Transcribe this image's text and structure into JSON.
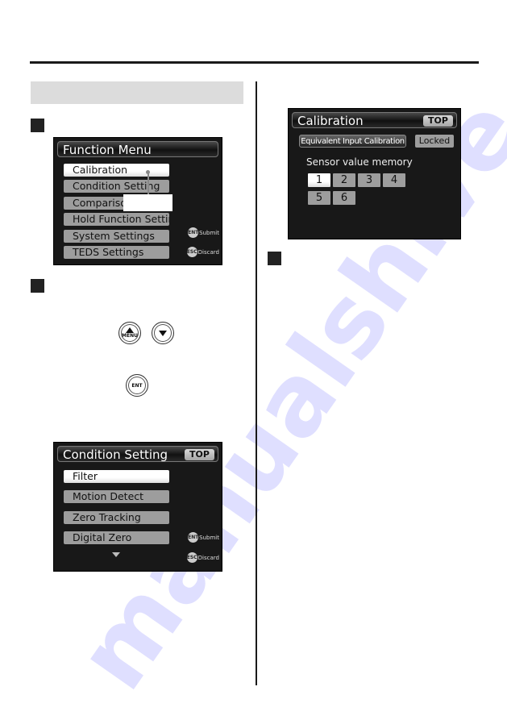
{
  "watermark": "manualshive.com",
  "function_menu_screen": {
    "title": "Function Menu",
    "items": [
      "Calibration",
      "Condition Setting",
      "Comparison",
      "Hold Function Setting",
      "System Settings",
      "TEDS Settings"
    ],
    "selected_index": 0,
    "hints": [
      {
        "key": "ENT",
        "label": "Submit"
      },
      {
        "key": "ESC",
        "label": "Discard"
      }
    ]
  },
  "keys": {
    "up_key_label": "MENU",
    "enter_key_label": "ENT"
  },
  "condition_setting_screen": {
    "title": "Condition Setting",
    "top_button": "TOP",
    "items": [
      "Filter",
      "Motion Detect",
      "Zero Tracking",
      "Digital Zero"
    ],
    "selected_index": 0,
    "hints": [
      {
        "key": "ENT",
        "label": "Submit"
      },
      {
        "key": "ESC",
        "label": "Discard"
      }
    ]
  },
  "calibration_screen": {
    "title": "Calibration",
    "top_button": "TOP",
    "equivalent_input_button": "Equivalent Input Calibration",
    "locked_button": "Locked",
    "memory_label": "Sensor value memory",
    "memory_slots": [
      "1",
      "2",
      "3",
      "4",
      "5",
      "6"
    ],
    "selected_slot": "1"
  }
}
